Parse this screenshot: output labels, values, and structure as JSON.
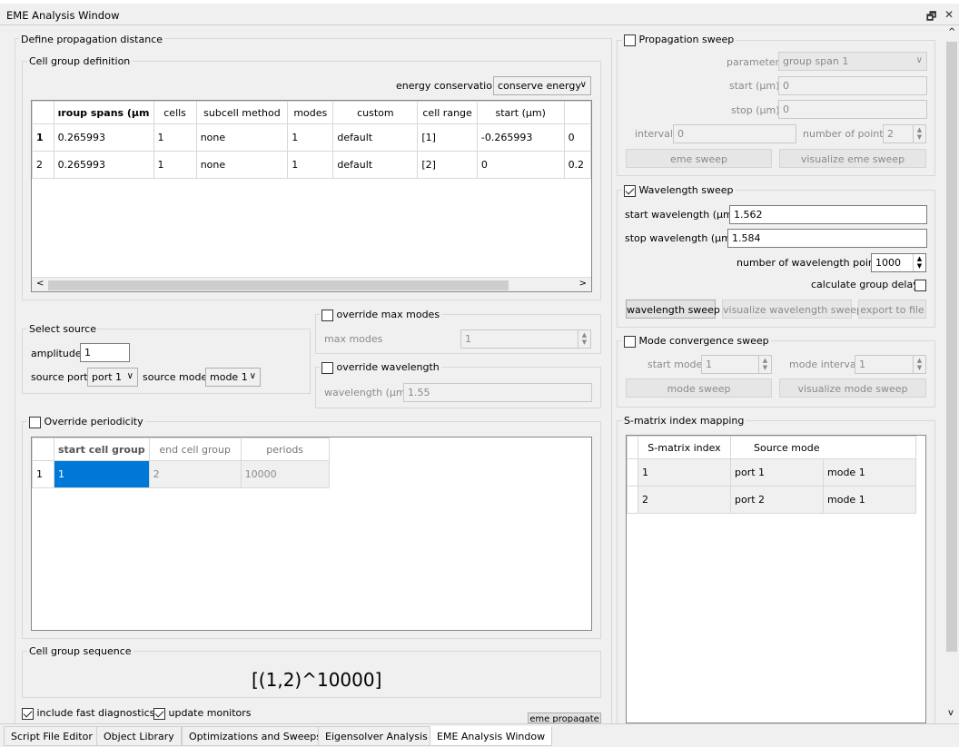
{
  "window": {
    "title": "EME Analysis Window",
    "restore_glyph": "🗗",
    "close_glyph": "✕"
  },
  "left": {
    "define_title": "Define propagation distance",
    "cell_group_title": "Cell group definition",
    "energy_label": "energy conservation",
    "energy_value": "conserve energy",
    "cell_table": {
      "headers": [
        "ıroup spans (µm",
        "cells",
        "subcell method",
        "modes",
        "custom",
        "cell range",
        "start (µm)",
        ""
      ],
      "rows": [
        [
          "1",
          "0.265993",
          "1",
          "none",
          "1",
          "default",
          "[1]",
          "-0.265993",
          "0"
        ],
        [
          "2",
          "0.265993",
          "1",
          "none",
          "1",
          "default",
          "[2]",
          "0",
          "0.2"
        ]
      ]
    },
    "select_source_title": "Select source",
    "amplitude_label": "amplitude",
    "amplitude_value": "1",
    "source_port_label": "source port",
    "source_port_value": "port 1",
    "source_mode_label": "source mode",
    "source_mode_value": "mode 1",
    "override_max_modes_label": "override max modes",
    "max_modes_label": "max modes",
    "max_modes_value": "1",
    "override_wavelength_label": "override wavelength",
    "wavelength_label": "wavelength (µm)",
    "wavelength_value": "1.55",
    "override_periodicity_label": "Override periodicity",
    "periodicity_table": {
      "headers": [
        "start cell group",
        "end cell group",
        "periods"
      ],
      "rows": [
        [
          "1",
          "1",
          "2",
          "10000"
        ]
      ]
    },
    "cell_group_sequence_title": "Cell group sequence",
    "sequence_value": "[(1,2)^10000]",
    "fast_diag_label": "include fast diagnostics",
    "update_monitors_label": "update monitors",
    "eme_propagate_label": "eme propagate"
  },
  "right": {
    "prop_sweep_label": "Propagation sweep",
    "parameter_label": "parameter",
    "parameter_value": "group span 1",
    "start_label": "start (µm)",
    "start_value": "0",
    "stop_label": "stop (µm)",
    "stop_value": "0",
    "interval_label": "interval",
    "interval_value": "0",
    "num_points_label": "number of points",
    "num_points_value": "2",
    "eme_sweep_label": "eme sweep",
    "visualize_eme_sweep_label": "visualize eme sweep",
    "wl_sweep_label": "Wavelength sweep",
    "start_wl_label": "start wavelength (µm)",
    "start_wl_value": "1.562",
    "stop_wl_label": "stop wavelength (µm)",
    "stop_wl_value": "1.584",
    "num_wl_points_label": "number of wavelength points",
    "num_wl_points_value": "1000",
    "calc_group_delays_label": "calculate group delays",
    "wavelength_sweep_btn": "wavelength sweep",
    "visualize_wl_sweep_btn": "visualize wavelength sweep",
    "export_btn": "export to file",
    "mode_conv_label": "Mode convergence sweep",
    "start_mode_label": "start mode",
    "start_mode_value": "1",
    "mode_interval_label": "mode interval",
    "mode_interval_value": "1",
    "mode_sweep_btn": "mode sweep",
    "visualize_mode_sweep_btn": "visualize mode sweep",
    "smatrix_title": "S-matrix index mapping",
    "smatrix_table": {
      "headers": [
        "S-matrix index",
        "Source mode",
        ""
      ],
      "rows": [
        [
          "1",
          "port 1",
          "mode 1"
        ],
        [
          "2",
          "port 2",
          "mode 1"
        ]
      ]
    }
  },
  "tabs": [
    "Script File Editor",
    "Object Library",
    "Optimizations and Sweeps",
    "Eigensolver Analysis",
    "EME Analysis Window"
  ],
  "active_tab": "EME Analysis Window",
  "colors": {
    "selection": "#0078d7",
    "disabled_text": "#8a8a8a"
  }
}
